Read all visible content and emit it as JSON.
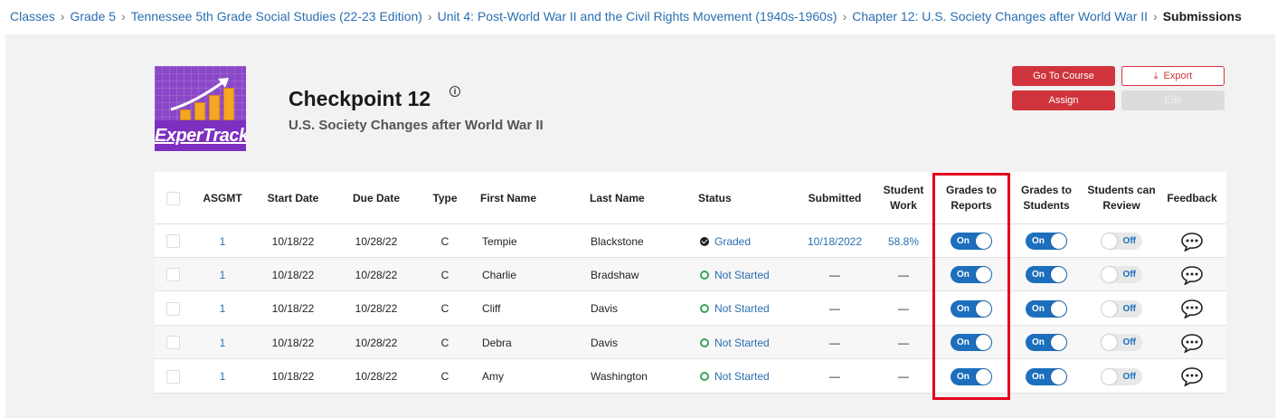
{
  "breadcrumb": {
    "items": [
      "Classes",
      "Grade 5",
      "Tennessee 5th Grade Social Studies (22-23 Edition)",
      "Unit 4: Post-World War II and the Civil Rights Movement (1940s-1960s)",
      "Chapter 12: U.S. Society Changes after World War II"
    ],
    "current": "Submissions"
  },
  "header": {
    "logo_text": "ExperTrack!",
    "title": "Checkpoint 12",
    "subtitle": "U.S. Society Changes after World War II",
    "info_glyph": "i"
  },
  "actions": {
    "go_to_course": "Go To Course",
    "export": "Export",
    "assign": "Assign",
    "edit": "Edit"
  },
  "table": {
    "columns": [
      "ASGMT",
      "Start Date",
      "Due Date",
      "Type",
      "First Name",
      "Last Name",
      "Status",
      "Submitted",
      "Student Work",
      "Grades to Reports",
      "Grades to Students",
      "Students can Review",
      "Feedback"
    ],
    "rows": [
      {
        "asgmt": "1",
        "start": "10/18/22",
        "due": "10/28/22",
        "type": "C",
        "first": "Tempie",
        "last": "Blackstone",
        "status": "Graded",
        "status_kind": "graded",
        "submitted": "10/18/2022",
        "work": "58.8%",
        "reports": "On",
        "students": "On",
        "review": "Off"
      },
      {
        "asgmt": "1",
        "start": "10/18/22",
        "due": "10/28/22",
        "type": "C",
        "first": "Charlie",
        "last": "Bradshaw",
        "status": "Not Started",
        "status_kind": "not-started",
        "submitted": "—",
        "work": "—",
        "reports": "On",
        "students": "On",
        "review": "Off"
      },
      {
        "asgmt": "1",
        "start": "10/18/22",
        "due": "10/28/22",
        "type": "C",
        "first": "Cliff",
        "last": "Davis",
        "status": "Not Started",
        "status_kind": "not-started",
        "submitted": "—",
        "work": "—",
        "reports": "On",
        "students": "On",
        "review": "Off"
      },
      {
        "asgmt": "1",
        "start": "10/18/22",
        "due": "10/28/22",
        "type": "C",
        "first": "Debra",
        "last": "Davis",
        "status": "Not Started",
        "status_kind": "not-started",
        "submitted": "—",
        "work": "—",
        "reports": "On",
        "students": "On",
        "review": "Off"
      },
      {
        "asgmt": "1",
        "start": "10/18/22",
        "due": "10/28/22",
        "type": "C",
        "first": "Amy",
        "last": "Washington",
        "status": "Not Started",
        "status_kind": "not-started",
        "submitted": "—",
        "work": "—",
        "reports": "On",
        "students": "On",
        "review": "Off"
      }
    ]
  },
  "colors": {
    "accent_red": "#d0343c",
    "link_blue": "#2a6fb0",
    "toggle_blue": "#1d6fbd",
    "status_green": "#3aa35c",
    "highlight_red": "#e3001b"
  },
  "icons": [
    "info-icon",
    "download-icon",
    "checkmark-circle-icon",
    "open-circle-icon",
    "chat-bubble-icon",
    "chevron-right-icon"
  ]
}
